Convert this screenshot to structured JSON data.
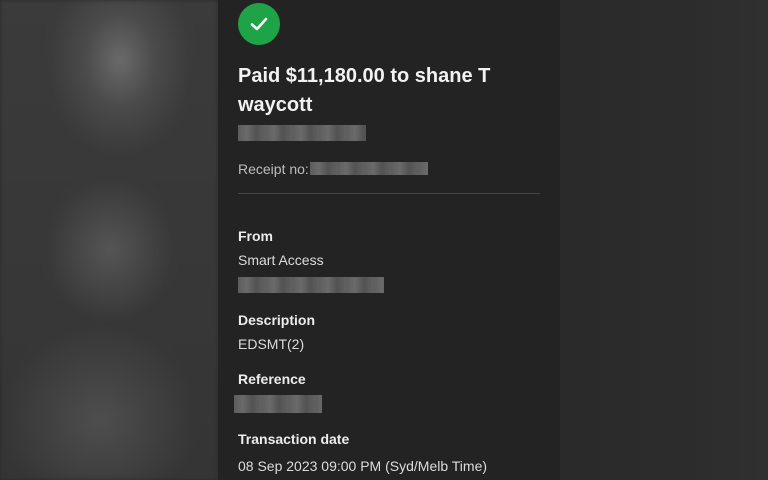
{
  "header": {
    "status_icon": "check-icon",
    "status_color": "#1ea446",
    "title": "Paid $11,180.00 to shane T waycott"
  },
  "receipt": {
    "label": "Receipt no:"
  },
  "details": {
    "from_label": "From",
    "from_value": "Smart Access",
    "description_label": "Description",
    "description_value": "EDSMT(2)",
    "reference_label": "Reference",
    "transaction_date_label": "Transaction date",
    "transaction_date_value": "08 Sep 2023 09:00 PM (Syd/Melb Time)"
  }
}
